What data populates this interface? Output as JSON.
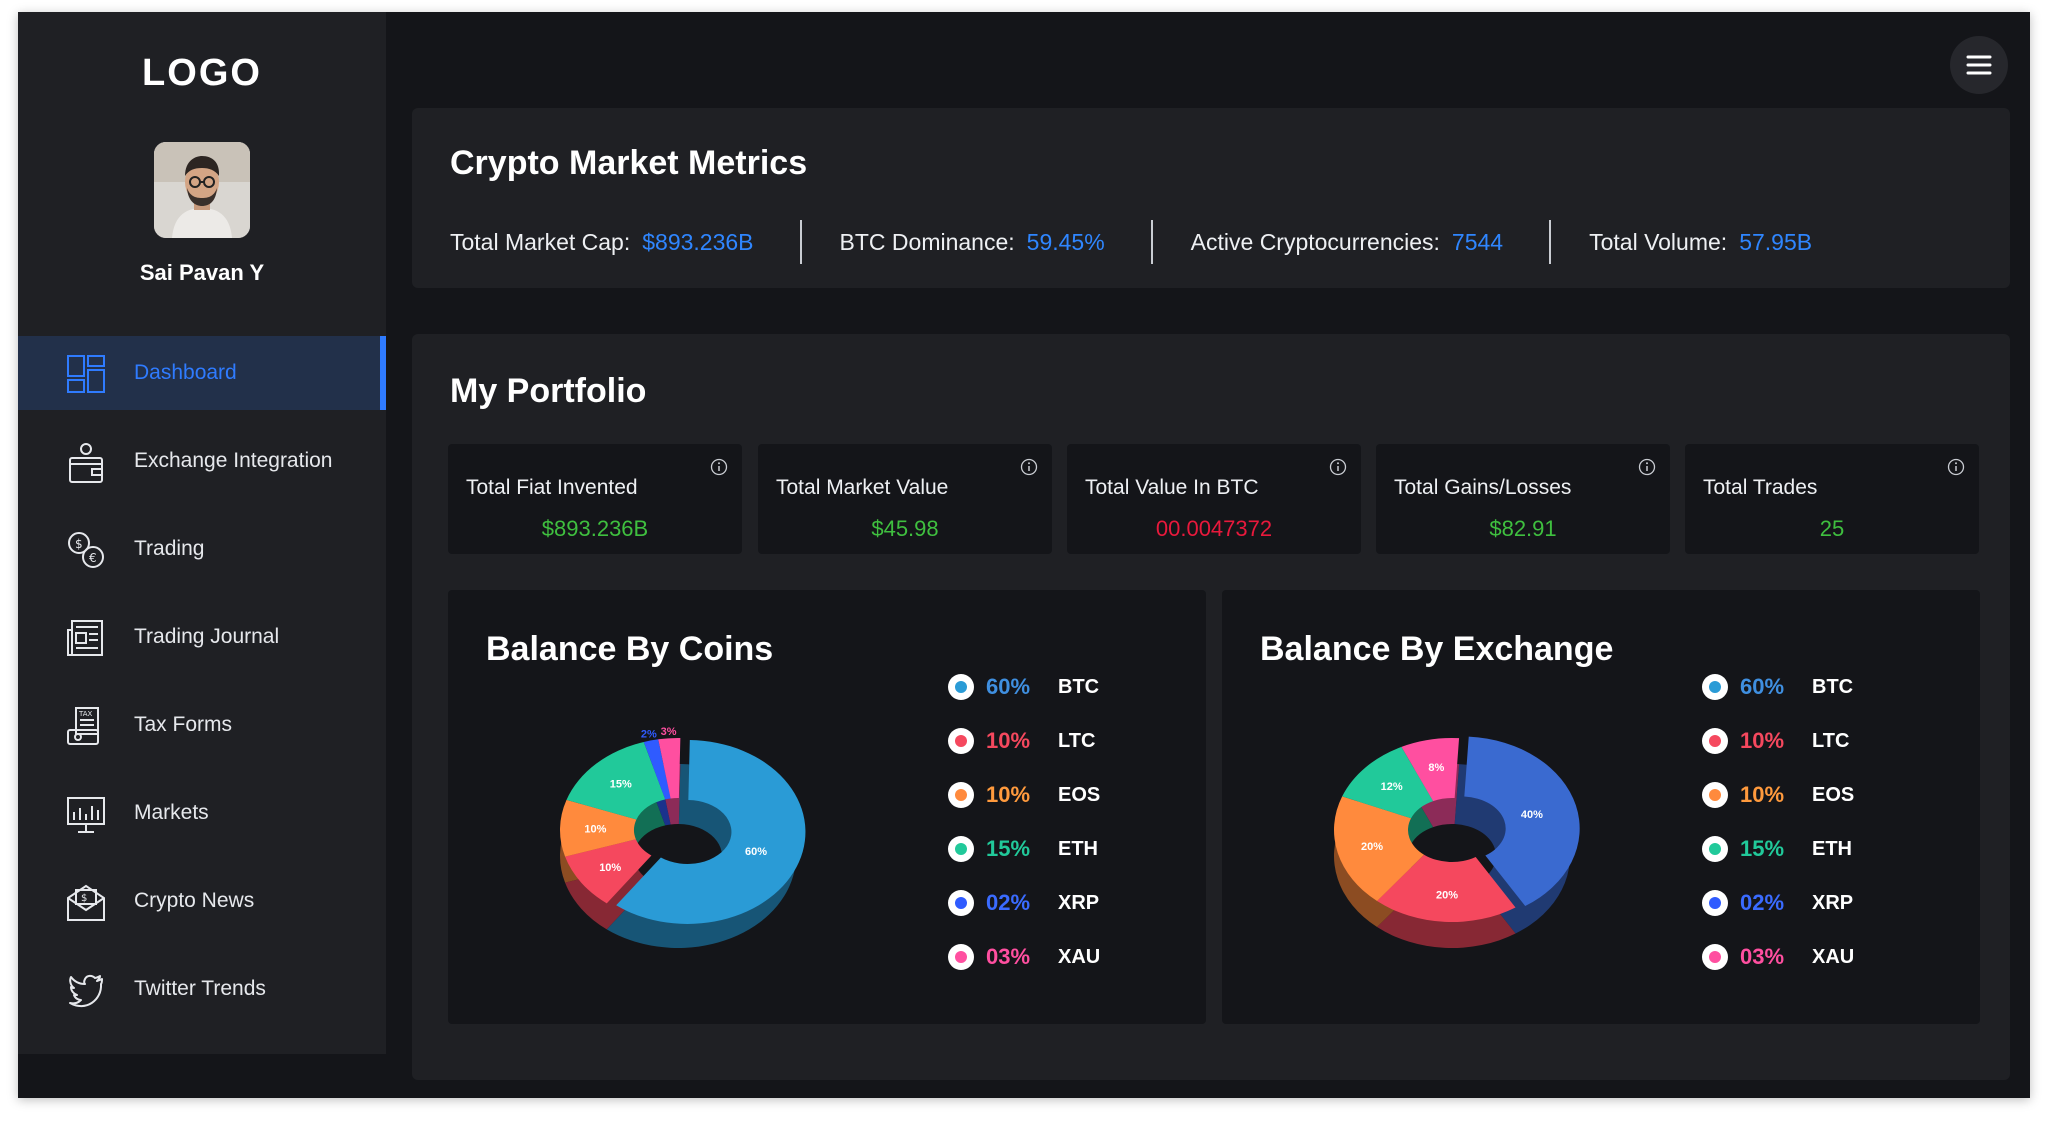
{
  "sidebar": {
    "logo": "LOGO",
    "user_name": "Sai Pavan Y",
    "items": [
      {
        "label": "Dashboard",
        "icon": "dashboard-icon",
        "active": true
      },
      {
        "label": "Exchange Integration",
        "icon": "wallet-icon",
        "active": false
      },
      {
        "label": "Trading",
        "icon": "currency-exchange-icon",
        "active": false
      },
      {
        "label": "Trading Journal",
        "icon": "newspaper-icon",
        "active": false
      },
      {
        "label": "Tax Forms",
        "icon": "tax-form-icon",
        "active": false
      },
      {
        "label": "Markets",
        "icon": "market-chart-icon",
        "active": false
      },
      {
        "label": "Crypto News",
        "icon": "mail-news-icon",
        "active": false
      },
      {
        "label": "Twitter Trends",
        "icon": "twitter-icon",
        "active": false
      }
    ]
  },
  "header": {
    "menu_icon": "hamburger-menu-icon"
  },
  "metrics": {
    "title": "Crypto Market Metrics",
    "items": [
      {
        "label": "Total Market Cap:",
        "value": "$893.236B"
      },
      {
        "label": "BTC Dominance:",
        "value": "59.45%"
      },
      {
        "label": "Active Cryptocurrencies:",
        "value": "7544"
      },
      {
        "label": "Total Volume:",
        "value": "57.95B"
      }
    ]
  },
  "portfolio": {
    "title": "My Portfolio",
    "stats": [
      {
        "label": "Total Fiat Invented",
        "value": "$893.236B",
        "color": "#3fbf3f"
      },
      {
        "label": "Total Market Value",
        "value": "$45.98",
        "color": "#3fbf3f"
      },
      {
        "label": "Total Value In BTC",
        "value": "00.0047372",
        "color": "#e8193c"
      },
      {
        "label": "Total Gains/Losses",
        "value": "$82.91",
        "color": "#3fbf3f"
      },
      {
        "label": "Total Trades",
        "value": "25",
        "color": "#3fbf3f"
      }
    ]
  },
  "colors": {
    "accent": "#2f7bff",
    "btc": "#2a9bd6",
    "ltc": "#f5485e",
    "eos": "#ff8a3d",
    "eth": "#21c99a",
    "xrp": "#2f5bff",
    "xau": "#ff4fa0"
  },
  "charts": {
    "coins": {
      "title": "Balance By Coins",
      "legend": [
        {
          "pct": "60%",
          "coin": "BTC",
          "color": "#2a9bd6",
          "pct_color": "#3f8fe0"
        },
        {
          "pct": "10%",
          "coin": "LTC",
          "color": "#f5485e",
          "pct_color": "#f5485e"
        },
        {
          "pct": "10%",
          "coin": "EOS",
          "color": "#ff8a3d",
          "pct_color": "#ff9a3d"
        },
        {
          "pct": "15%",
          "coin": "ETH",
          "color": "#21c99a",
          "pct_color": "#21c99a"
        },
        {
          "pct": "02%",
          "coin": "XRP",
          "color": "#2f5bff",
          "pct_color": "#3a6bff"
        },
        {
          "pct": "03%",
          "coin": "XAU",
          "color": "#ff4fa0",
          "pct_color": "#ff4fa0"
        }
      ]
    },
    "exchange": {
      "title": "Balance By Exchange",
      "legend": [
        {
          "pct": "60%",
          "coin": "BTC",
          "color": "#2a9bd6",
          "pct_color": "#3f8fe0"
        },
        {
          "pct": "10%",
          "coin": "LTC",
          "color": "#f5485e",
          "pct_color": "#f5485e"
        },
        {
          "pct": "10%",
          "coin": "EOS",
          "color": "#ff8a3d",
          "pct_color": "#ff9a3d"
        },
        {
          "pct": "15%",
          "coin": "ETH",
          "color": "#21c99a",
          "pct_color": "#21c99a"
        },
        {
          "pct": "02%",
          "coin": "XRP",
          "color": "#2f5bff",
          "pct_color": "#3a6bff"
        },
        {
          "pct": "03%",
          "coin": "XAU",
          "color": "#ff4fa0",
          "pct_color": "#ff4fa0"
        }
      ]
    }
  },
  "chart_data": [
    {
      "type": "pie",
      "title": "Balance By Coins",
      "categories": [
        "BTC",
        "LTC",
        "EOS",
        "ETH",
        "XRP",
        "XAU"
      ],
      "values": [
        60,
        10,
        10,
        15,
        2,
        3
      ],
      "labels": [
        "60%",
        "10%",
        "10%",
        "15%",
        "2%",
        "3%"
      ],
      "colors": [
        "#2a9bd6",
        "#f5485e",
        "#ff8a3d",
        "#21c99a",
        "#2f5bff",
        "#ff4fa0"
      ]
    },
    {
      "type": "pie",
      "title": "Balance By Exchange",
      "values": [
        40,
        20,
        20,
        12,
        8
      ],
      "labels": [
        "40%",
        "20%",
        "20%",
        "12%",
        "8%"
      ],
      "colors": [
        "#3a6ad0",
        "#f5485e",
        "#ff8a3d",
        "#21c99a",
        "#ff4fa0"
      ]
    }
  ]
}
